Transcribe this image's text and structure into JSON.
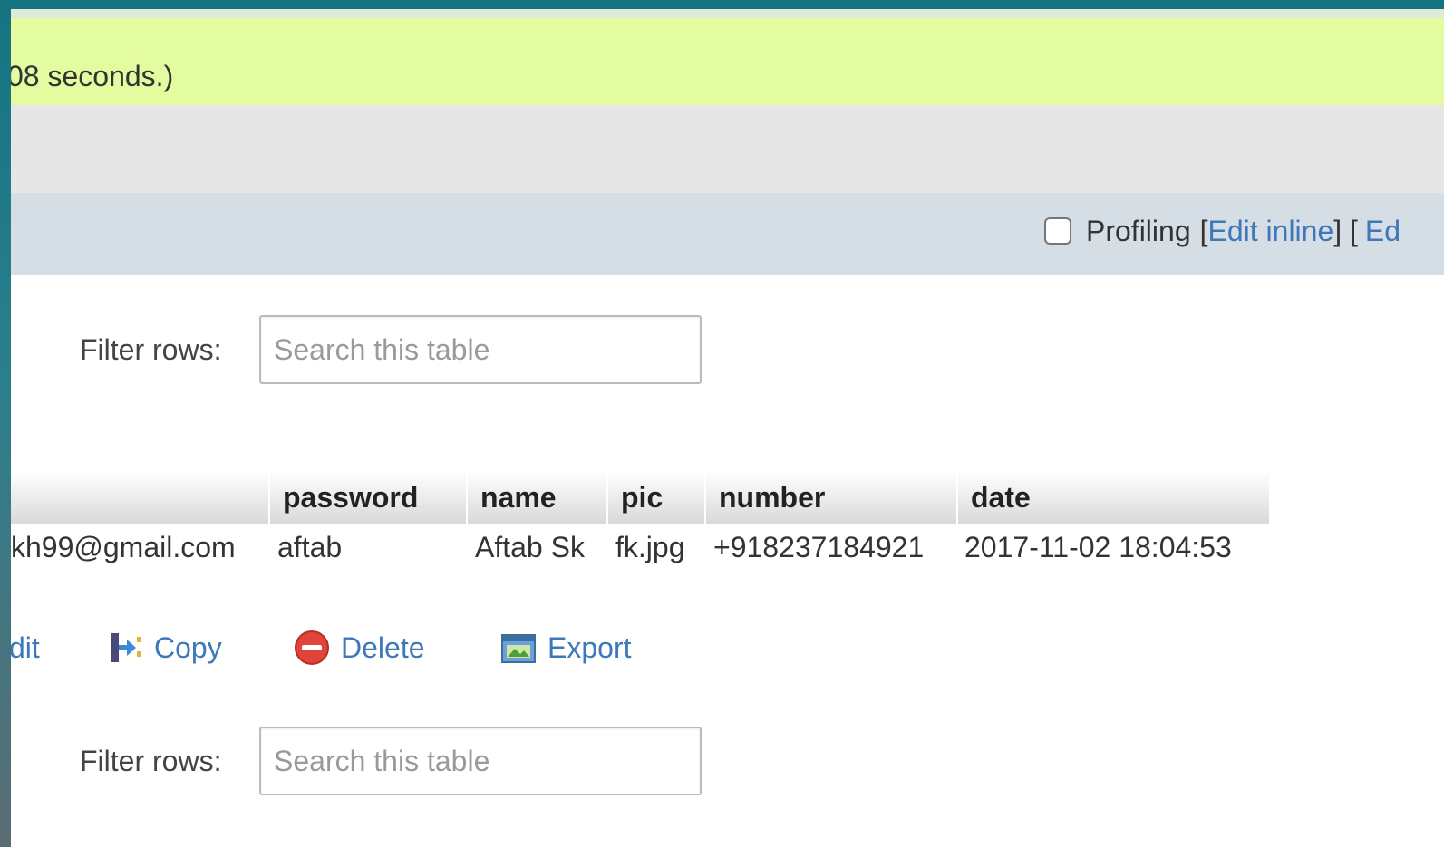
{
  "status": {
    "query_message": "08 seconds.)"
  },
  "options": {
    "profiling_label": "Profiling",
    "bracket_open": "[",
    "edit_inline": "Edit inline",
    "bracket_close_open": "] [",
    "edit_partial": "Ed"
  },
  "filter": {
    "label": "Filter rows:",
    "placeholder": "Search this table"
  },
  "table": {
    "columns": [
      "password",
      "name",
      "pic",
      "number",
      "date"
    ],
    "row": {
      "email": "kh99@gmail.com",
      "password": "aftab",
      "name": "Aftab Sk",
      "pic": "fk.jpg",
      "number": "+918237184921",
      "date": "2017-11-02 18:04:53"
    }
  },
  "actions": {
    "edit": "dit",
    "copy": "Copy",
    "delete": "Delete",
    "export": "Export"
  },
  "icons": {
    "copy": "copy-icon",
    "delete": "delete-icon",
    "export": "export-icon"
  },
  "colors": {
    "success_bg": "#e4fca0",
    "link": "#3f78b8",
    "options_bg": "#d5dde5",
    "delete_red": "#e0443a"
  }
}
